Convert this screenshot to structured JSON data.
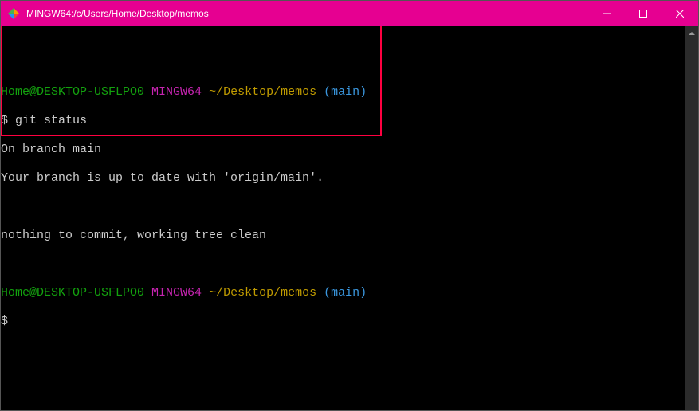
{
  "titlebar": {
    "title": "MINGW64:/c/Users/Home/Desktop/memos"
  },
  "prompt1": {
    "userhost": "Home@DESKTOP-USFLPO0",
    "env": "MINGW64",
    "path": "~/Desktop/memos",
    "branch": "(main)"
  },
  "cmd1": {
    "symbol": "$",
    "command": "git status"
  },
  "output": {
    "line1": "On branch main",
    "line2": "Your branch is up to date with 'origin/main'.",
    "line3": "",
    "line4": "nothing to commit, working tree clean"
  },
  "prompt2": {
    "userhost": "Home@DESKTOP-USFLPO0",
    "env": "MINGW64",
    "path": "~/Desktop/memos",
    "branch": "(main)"
  },
  "cmd2": {
    "symbol": "$"
  }
}
